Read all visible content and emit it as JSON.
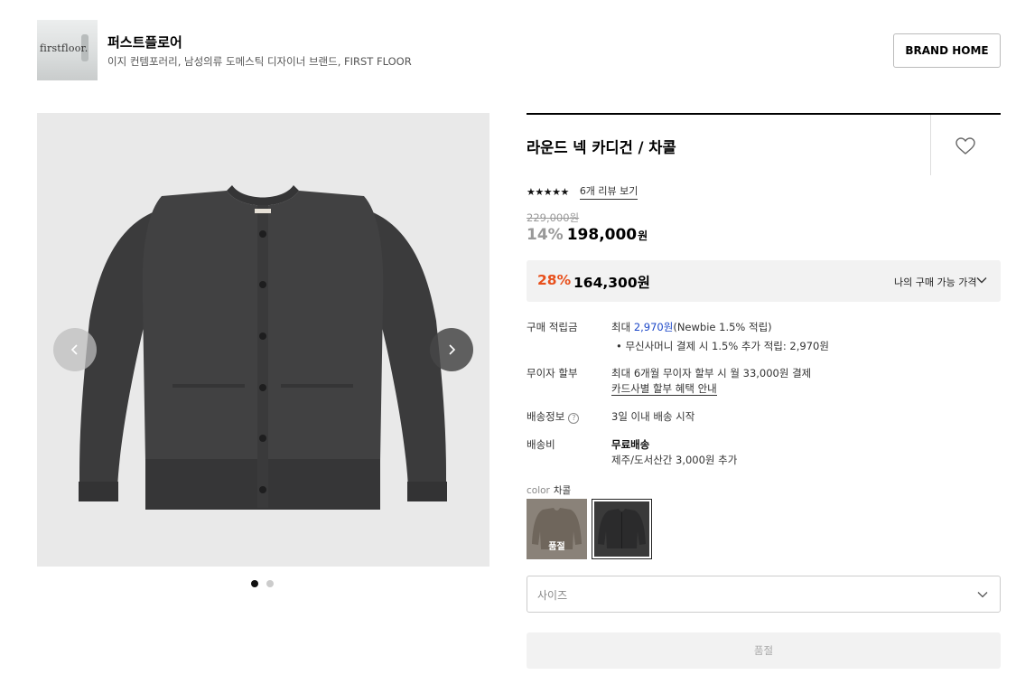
{
  "brand": {
    "logo_text": "firstfloor.",
    "name": "퍼스트플로어",
    "description": "이지 컨템포러리, 남성의류 도메스틱 디자이너 브랜드, FIRST FLOOR",
    "home_button": "BRAND HOME"
  },
  "gallery": {
    "image_count": 2,
    "active_index": 1,
    "icons": {
      "prev": "chevron-left-icon",
      "next": "chevron-right-icon"
    }
  },
  "product": {
    "title": "라운드 넥 카디건 / 차콜",
    "rating_stars": "★★★★★",
    "rating_value": 4.5,
    "review_link": "6개 리뷰 보기",
    "original_price": "229,000원",
    "discount_rate": "14%",
    "sale_price": "198,000",
    "sale_unit": "원"
  },
  "my_price": {
    "discount_rate": "28%",
    "price": "164,300원",
    "label": "나의 구매 가능 가격"
  },
  "info": {
    "points": {
      "label": "구매 적립금",
      "prefix": "최대 ",
      "amount": "2,970원",
      "suffix": "(Newbie 1.5% 적립)",
      "sub": "• 무신사머니 결제 시 1.5% 추가 적립: 2,970원"
    },
    "installment": {
      "label": "무이자 할부",
      "value": "최대 6개월 무이자 할부 시 월 33,000원 결제",
      "link": "카드사별 할부 혜택 안내"
    },
    "delivery": {
      "label": "배송정보",
      "help": "?",
      "value": "3일 이내 배송 시작"
    },
    "shipping_fee": {
      "label": "배송비",
      "value": "무료배송",
      "sub": "제주/도서산간 3,000원 추가"
    }
  },
  "options": {
    "color_label": "color",
    "color_selected": "차콜",
    "swatches": [
      {
        "color": "#8a8279",
        "badge": "품절"
      },
      {
        "color": "#3a3a3a",
        "badge": ""
      }
    ],
    "size_placeholder": "사이즈",
    "buy_button": "품절"
  },
  "colors": {
    "accent_orange": "#e8501c",
    "accent_blue": "#1d48c8",
    "garment": "#3d3d3e"
  }
}
